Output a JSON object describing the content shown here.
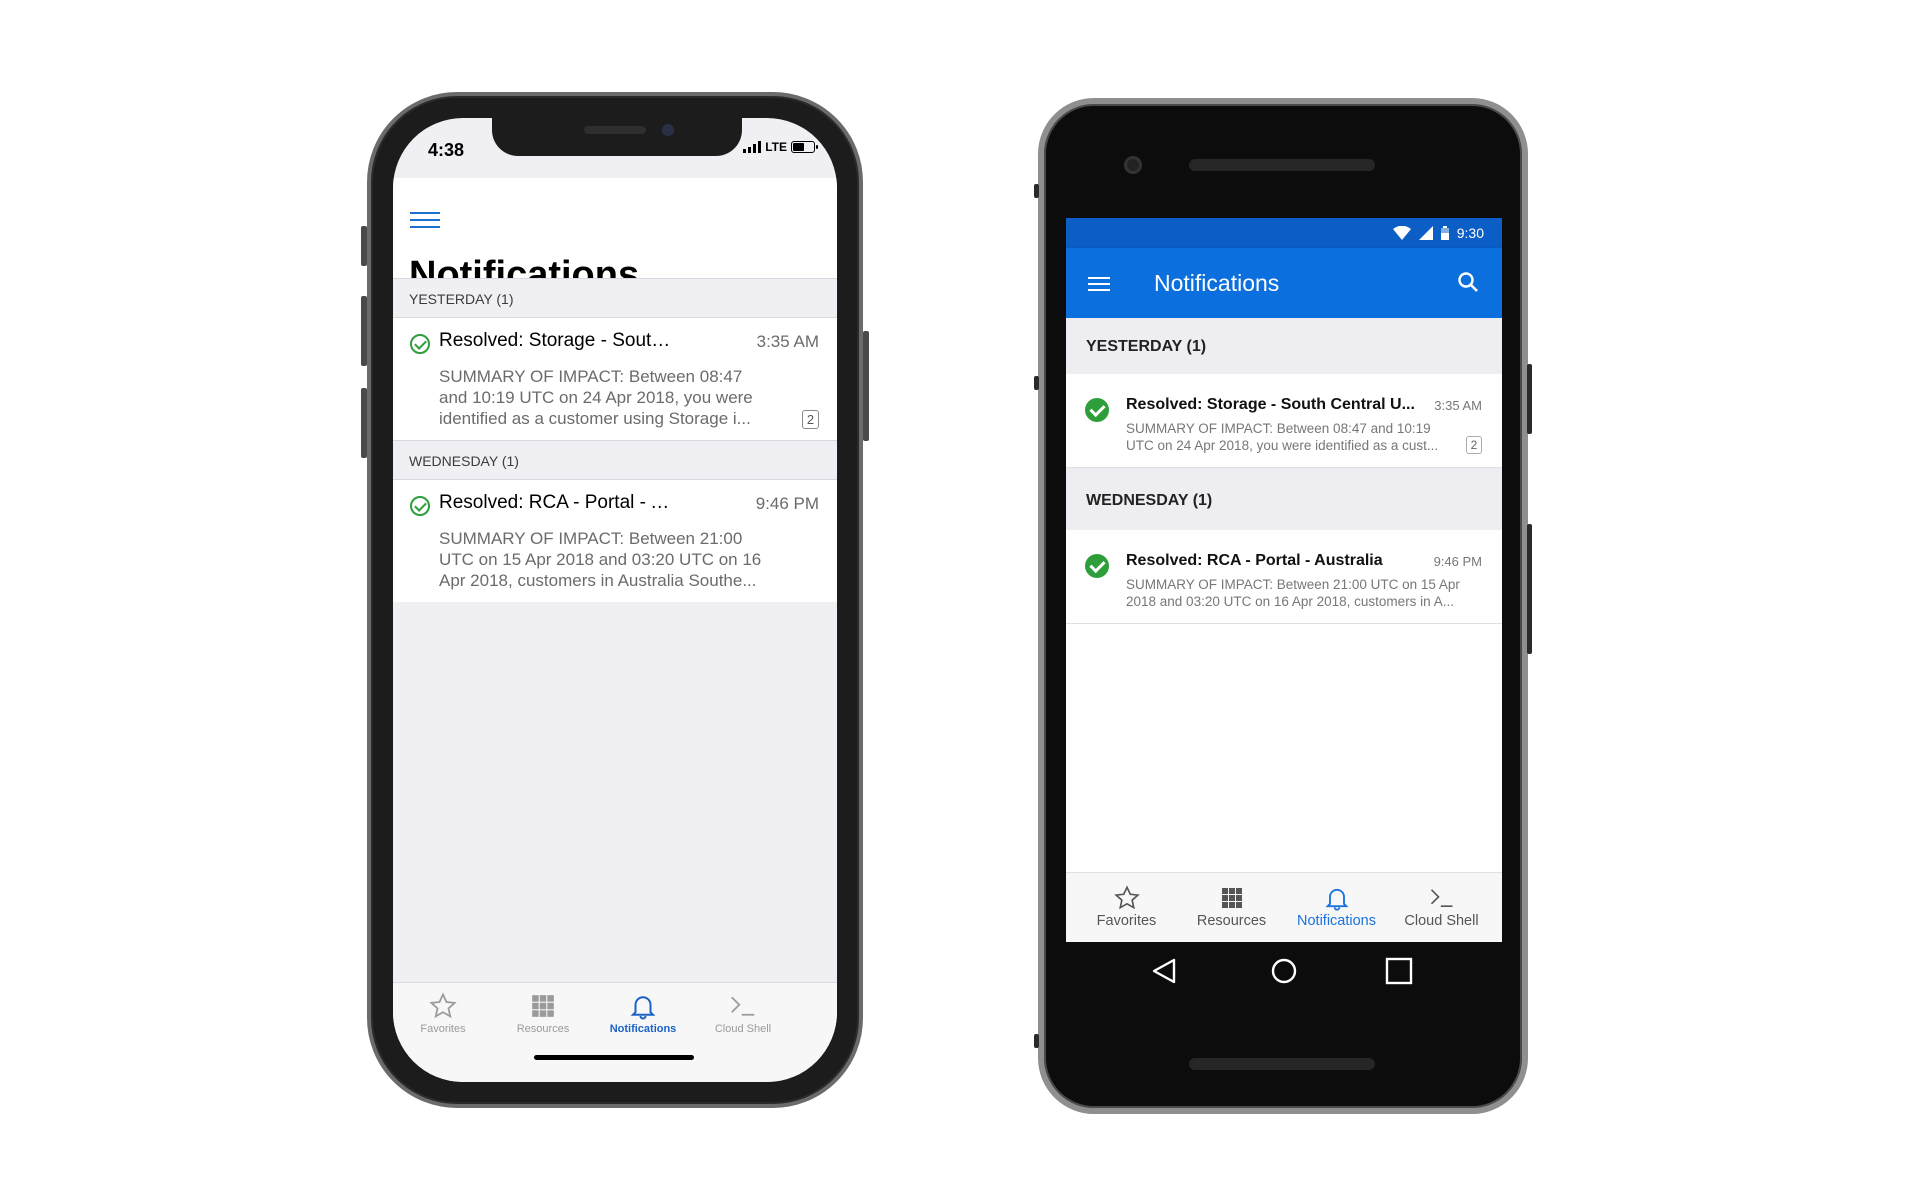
{
  "colors": {
    "ios_accent": "#1a62c8",
    "android_appbar": "#0b6fdd",
    "resolved_green": "#2e9e3b"
  },
  "ios": {
    "status": {
      "time": "4:38",
      "network": "LTE"
    },
    "title": "Notifications",
    "menu_icon": "hamburger-icon",
    "sections": [
      {
        "label": "YESTERDAY (1)",
        "items": [
          {
            "title": "Resolved: Storage - South Ce...",
            "time": "3:35 AM",
            "summary": "SUMMARY OF IMPACT: Between 08:47 and 10:19 UTC on 24 Apr 2018, you were identified as a customer using Storage i...",
            "count": "2"
          }
        ]
      },
      {
        "label": "WEDNESDAY (1)",
        "items": [
          {
            "title": "Resolved: RCA - Portal - Austr...",
            "time": "9:46 PM",
            "summary": "SUMMARY OF IMPACT: Between 21:00 UTC on 15 Apr 2018 and 03:20 UTC on 16 Apr 2018, customers in Australia Southe..."
          }
        ]
      }
    ],
    "tabs": [
      {
        "label": "Favorites",
        "icon": "star-icon"
      },
      {
        "label": "Resources",
        "icon": "grid-icon"
      },
      {
        "label": "Notifications",
        "icon": "bell-icon",
        "active": true
      },
      {
        "label": "Cloud Shell",
        "icon": "terminal-icon"
      }
    ]
  },
  "android": {
    "status": {
      "time": "9:30"
    },
    "title": "Notifications",
    "sections": [
      {
        "label": "YESTERDAY (1)",
        "items": [
          {
            "title": "Resolved: Storage - South Central U...",
            "time": "3:35 AM",
            "summary": "SUMMARY OF IMPACT: Between 08:47 and 10:19 UTC on 24 Apr 2018, you were identified as a cust...",
            "count": "2"
          }
        ]
      },
      {
        "label": "WEDNESDAY (1)",
        "items": [
          {
            "title": "Resolved: RCA - Portal - Australia",
            "time": "9:46 PM",
            "summary": "SUMMARY OF IMPACT: Between 21:00 UTC on 15 Apr 2018 and 03:20 UTC on 16 Apr 2018, customers in A..."
          }
        ]
      }
    ],
    "tabs": [
      {
        "label": "Favorites",
        "icon": "star-icon"
      },
      {
        "label": "Resources",
        "icon": "grid-icon"
      },
      {
        "label": "Notifications",
        "icon": "bell-icon",
        "active": true
      },
      {
        "label": "Cloud Shell",
        "icon": "terminal-icon"
      }
    ]
  }
}
